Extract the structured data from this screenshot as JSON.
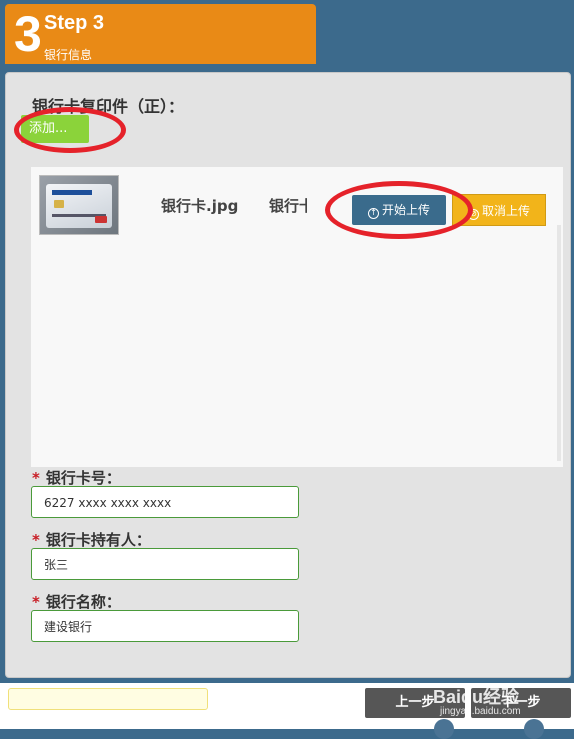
{
  "step": {
    "number": "3",
    "title": "Step 3",
    "subtitle": "银行信息"
  },
  "upload": {
    "label": "银行卡复印件（正）：",
    "add_label": "添加...",
    "file": {
      "name": "银行卡.jpg",
      "desc": "银行卡",
      "start_label": "开始上传",
      "cancel_label": "取消上传"
    }
  },
  "fields": [
    {
      "label": "银行卡号：",
      "value": "6227 xxxx xxxx xxxx"
    },
    {
      "label": "银行卡持有人：",
      "value": "张三"
    },
    {
      "label": "银行名称：",
      "value": "建设银行"
    }
  ],
  "footer": {
    "prev_label": "上一步",
    "next_label": "下一步"
  },
  "watermark": {
    "main": "Baidu经验",
    "sub": "jingyan.baidu.com"
  },
  "colors": {
    "accent": "#e98a16",
    "background": "#3c6a8c",
    "highlight": "#e5222a"
  }
}
